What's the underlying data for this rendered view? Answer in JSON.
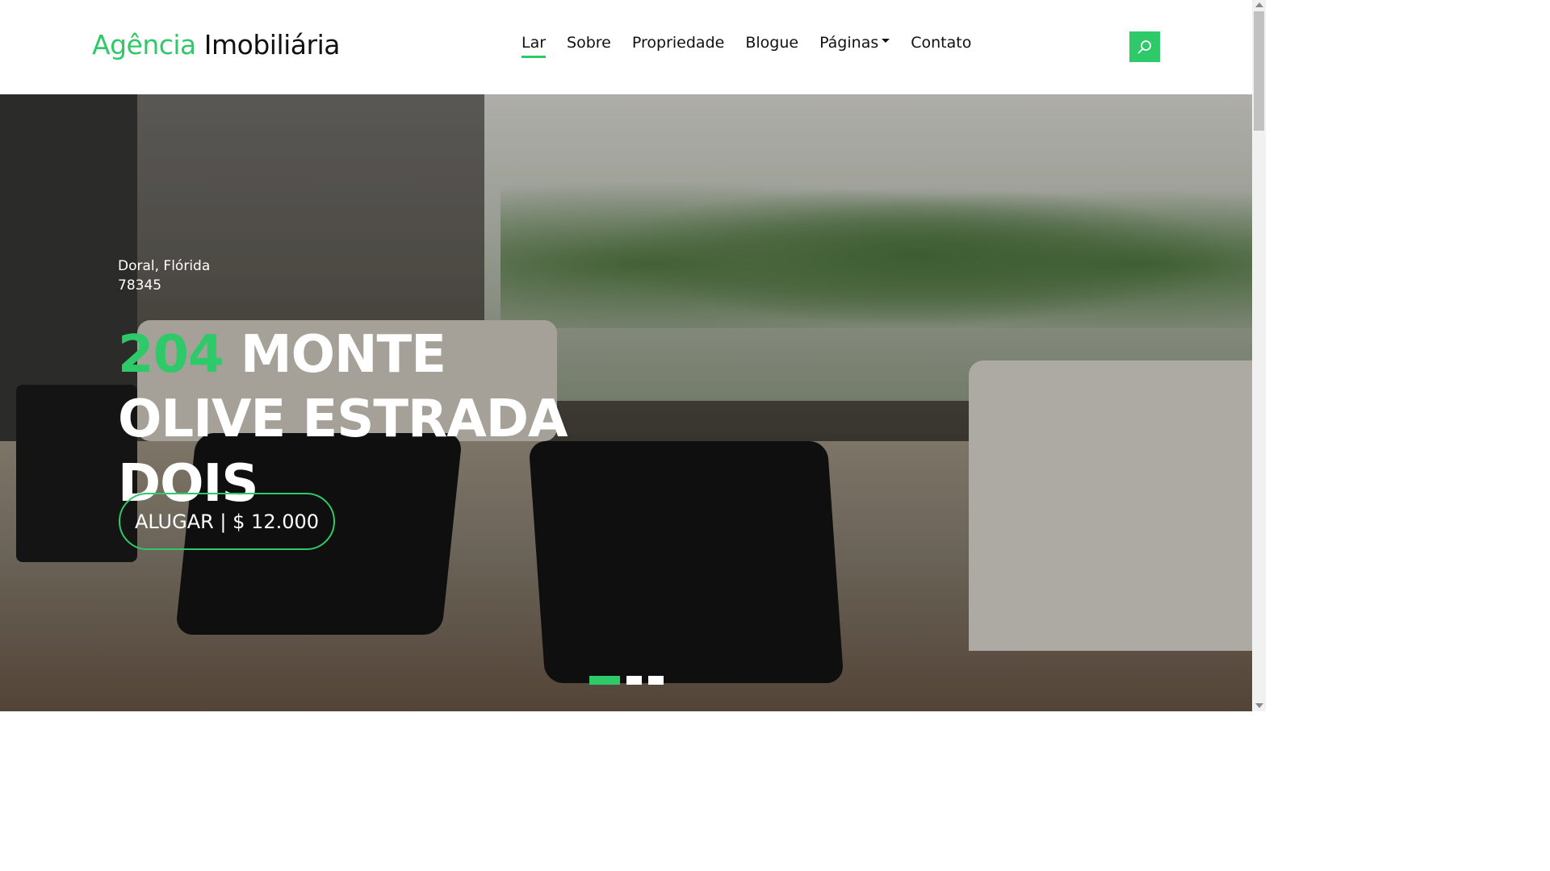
{
  "brand": {
    "accent_text": "Agência",
    "rest_text": "Imobiliária"
  },
  "nav": {
    "items": [
      {
        "label": "Lar",
        "active": true
      },
      {
        "label": "Sobre"
      },
      {
        "label": "Propriedade"
      },
      {
        "label": "Blogue"
      },
      {
        "label": "Páginas",
        "has_dropdown": true
      },
      {
        "label": "Contato"
      }
    ],
    "search_icon": "search-icon"
  },
  "hero": {
    "location_line1": "Doral, Flórida",
    "location_line2": "78345",
    "title_number": "204",
    "title_rest_line1": "MONTE",
    "title_line2": "OLIVE ESTRADA DOIS",
    "button_label": "ALUGAR | $ 12.000",
    "slides": {
      "count": 3,
      "active_index": 0
    }
  },
  "colors": {
    "accent": "#2eca6a",
    "text_dark": "#111111"
  }
}
